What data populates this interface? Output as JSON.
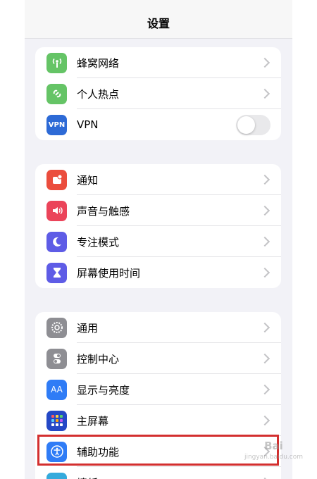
{
  "nav": {
    "title": "设置"
  },
  "groups": [
    {
      "items": [
        {
          "label": "蜂窝网络",
          "icon": "cellular-icon",
          "color": "#65c466"
        },
        {
          "label": "个人热点",
          "icon": "hotspot-icon",
          "color": "#65c466"
        },
        {
          "label": "VPN",
          "icon": "vpn-icon",
          "color": "#2d6ad6",
          "toggle": false,
          "icon_text": "VPN"
        }
      ]
    },
    {
      "items": [
        {
          "label": "通知",
          "icon": "notifications-icon",
          "color": "#eb4d3d"
        },
        {
          "label": "声音与触感",
          "icon": "sound-icon",
          "color": "#eb445a"
        },
        {
          "label": "专注模式",
          "icon": "focus-moon-icon",
          "color": "#5e5ce6"
        },
        {
          "label": "屏幕使用时间",
          "icon": "hourglass-icon",
          "color": "#5e5ce6"
        }
      ]
    },
    {
      "items": [
        {
          "label": "通用",
          "icon": "gear-icon",
          "color": "#8e8e93"
        },
        {
          "label": "控制中心",
          "icon": "control-center-icon",
          "color": "#8e8e93"
        },
        {
          "label": "显示与亮度",
          "icon": "display-icon",
          "color": "#2f7cf6",
          "icon_text": "AA"
        },
        {
          "label": "主屏幕",
          "icon": "home-screen-icon",
          "color": "#2448c6"
        },
        {
          "label": "辅助功能",
          "icon": "accessibility-icon",
          "color": "#2f7cf6"
        },
        {
          "label": "墙纸",
          "icon": "wallpaper-icon",
          "color": "#35aadc"
        }
      ]
    }
  ],
  "watermark": {
    "text": "Bai",
    "sub": "jingyan.baidu.com"
  }
}
